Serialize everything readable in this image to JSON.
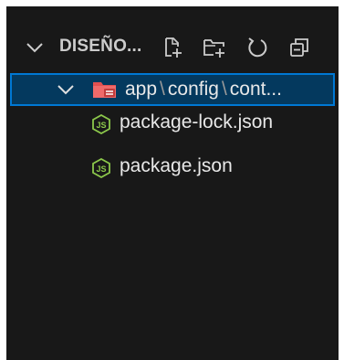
{
  "explorer": {
    "section_title": "DISEÑO...",
    "actions": {
      "new_file_icon": "new-file-icon",
      "new_folder_icon": "new-folder-icon",
      "refresh_icon": "refresh-icon",
      "collapse_icon": "collapse-all-icon"
    },
    "folder": {
      "path_segments": [
        "app",
        "config",
        "cont..."
      ],
      "separator": "\\",
      "expanded": true,
      "selected": true,
      "icon": "folder-config-icon"
    },
    "files": [
      {
        "name": "package-lock.json",
        "icon": "nodejs-icon"
      },
      {
        "name": "package.json",
        "icon": "nodejs-icon"
      }
    ]
  },
  "colors": {
    "background": "#181818",
    "selection_bg": "#04395e",
    "selection_border": "#0078d4",
    "folder_red": "#e35050",
    "nodejs_green": "#8cc84b"
  }
}
